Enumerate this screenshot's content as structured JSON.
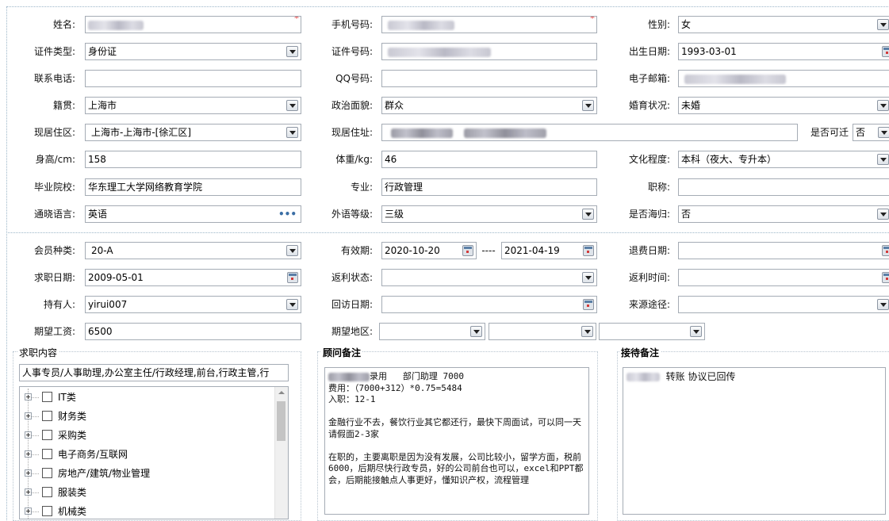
{
  "form": {
    "name": {
      "label": "姓名:",
      "required": "*"
    },
    "mobile": {
      "label": "手机号码:",
      "required": "*"
    },
    "gender": {
      "label": "性别:",
      "value": "女"
    },
    "id_type": {
      "label": "证件类型:",
      "value": "身份证"
    },
    "id_no": {
      "label": "证件号码:"
    },
    "birth": {
      "label": "出生日期:",
      "value": "1993-03-01"
    },
    "phone": {
      "label": "联系电话:",
      "value": ""
    },
    "qq": {
      "label": "QQ号码:",
      "value": ""
    },
    "email": {
      "label": "电子邮箱:"
    },
    "native": {
      "label": "籍贯:",
      "value": "上海市"
    },
    "politics": {
      "label": "政治面貌:",
      "value": "群众"
    },
    "marital": {
      "label": "婚育状况:",
      "value": "未婚"
    },
    "district": {
      "label": "现居住区:",
      "value": "上海市-上海市-[徐汇区]"
    },
    "address": {
      "label": "现居住址:"
    },
    "relocate": {
      "label": "是否可迁",
      "value": "否"
    },
    "height": {
      "label": "身高/cm:",
      "value": "158"
    },
    "weight": {
      "label": "体重/kg:",
      "value": "46"
    },
    "education": {
      "label": "文化程度:",
      "value": "本科（夜大、专升本）"
    },
    "school": {
      "label": "毕业院校:",
      "value": "华东理工大学网络教育学院"
    },
    "major": {
      "label": "专业:",
      "value": "行政管理"
    },
    "title": {
      "label": "职称:",
      "value": ""
    },
    "language": {
      "label": "通晓语言:",
      "value": "英语",
      "more": "•••"
    },
    "lang_level": {
      "label": "外语等级:",
      "value": "三级"
    },
    "returnee": {
      "label": "是否海归:",
      "value": "否"
    }
  },
  "membership": {
    "member_type": {
      "label": "会员种类:",
      "value": "20-A"
    },
    "valid": {
      "label": "有效期:",
      "from": "2020-10-20",
      "sep": "----",
      "to": "2021-04-19"
    },
    "refund_date": {
      "label": "退费日期:",
      "value": ""
    },
    "job_date": {
      "label": "求职日期:",
      "value": "2009-05-01"
    },
    "rebate_status": {
      "label": "返利状态:",
      "value": ""
    },
    "rebate_time": {
      "label": "返利时间:",
      "value": ""
    },
    "holder": {
      "label": "持有人:",
      "value": "yirui007"
    },
    "visit_date": {
      "label": "回访日期:",
      "value": ""
    },
    "source": {
      "label": "来源途径:",
      "value": ""
    },
    "salary": {
      "label": "期望工资:",
      "value": "6500"
    },
    "area": {
      "label": "期望地区:"
    }
  },
  "job_content": {
    "title": "求职内容",
    "summary": "人事专员/人事助理,办公室主任/行政经理,前台,行政主管,行",
    "categories": [
      "IT类",
      "财务类",
      "采购类",
      "电子商务/互联网",
      "房地产/建筑/物业管理",
      "服装类",
      "机械类"
    ]
  },
  "consultant": {
    "title": "顾问备注",
    "line1_suffix": "录用   部门助理 7000",
    "body": "费用：（7000+312）*0.75=5484\n入职：12-1\n\n金融行业不去，餐饮行业其它都还行，最快下周面试，可以同一天请假面2-3家\n\n在职的，主要离职是因为没有发展，公司比较小，留学方面，税前6000，后期尽快行政专员，好的公司前台也可以，excel和PPT都会，后期能接触点人事更好，懂知识产权，流程管理"
  },
  "reception": {
    "title": "接待备注",
    "line1_suffix": "转账 协议已回传"
  }
}
